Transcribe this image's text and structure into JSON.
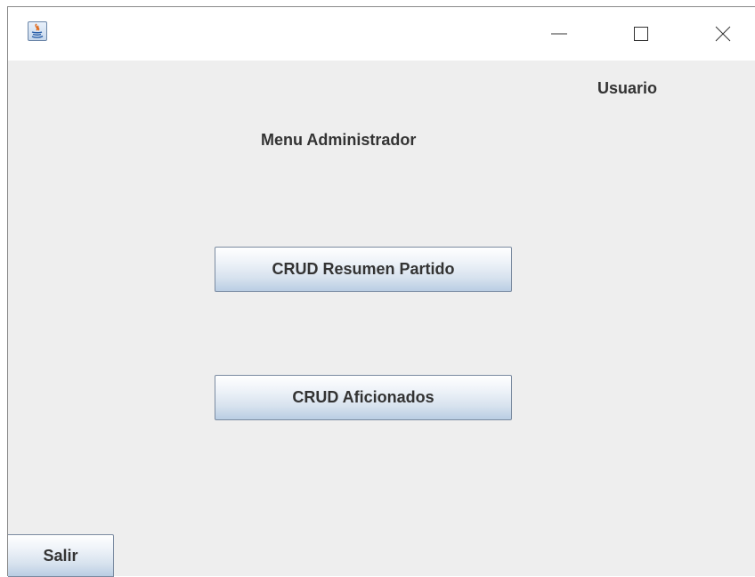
{
  "window": {
    "title": "",
    "controls": {
      "minimize_icon": "minimize-icon",
      "maximize_icon": "maximize-icon",
      "close_icon": "close-icon"
    }
  },
  "labels": {
    "user": "Usuario",
    "menu_title": "Menu Administrador"
  },
  "buttons": {
    "crud_resumen": "CRUD Resumen Partido",
    "crud_aficionados": "CRUD Aficionados",
    "salir": "Salir"
  },
  "colors": {
    "background": "#eeeeee",
    "button_border": "#7a8aa0",
    "text": "#333333"
  }
}
